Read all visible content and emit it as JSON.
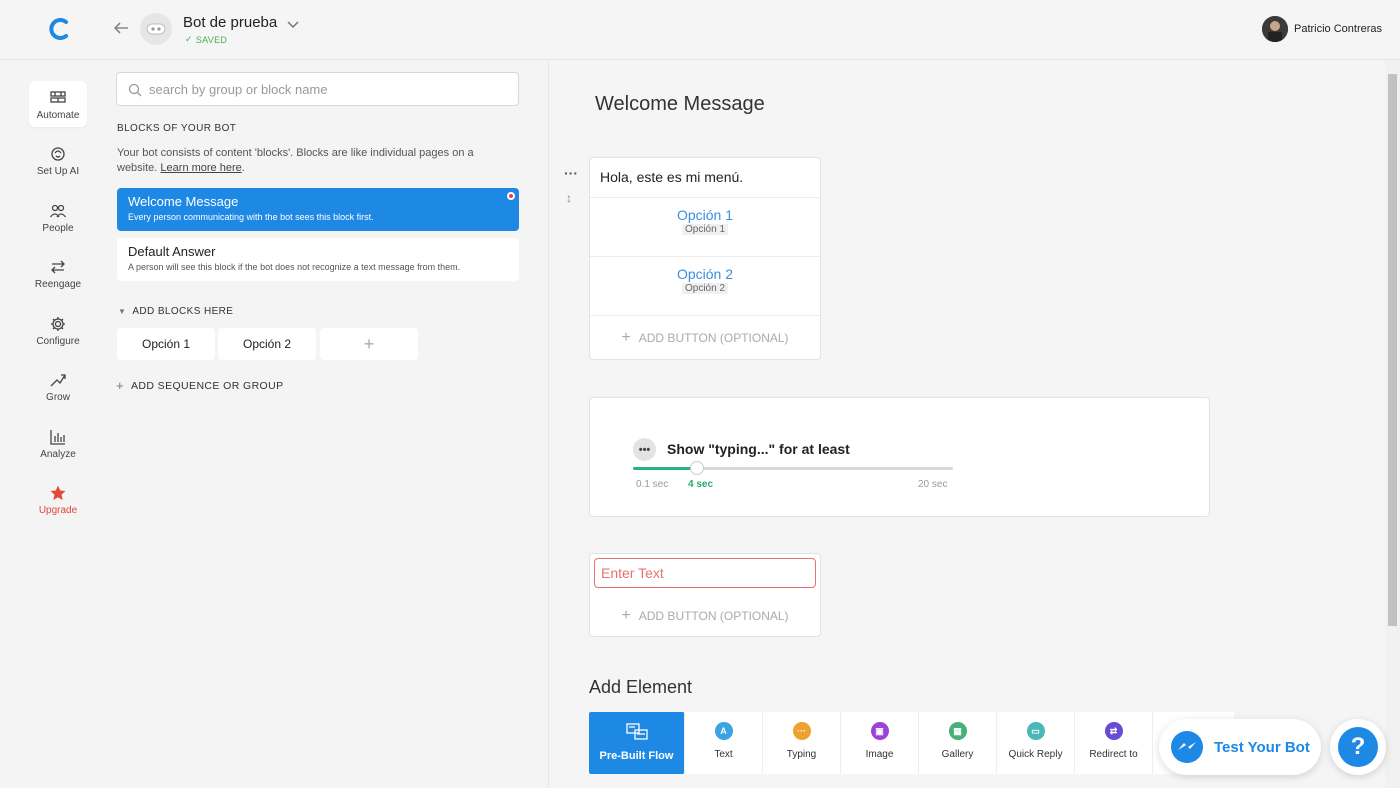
{
  "header": {
    "bot_name": "Bot de prueba",
    "saved_status": "SAVED",
    "user_name": "Patricio Contreras"
  },
  "nav": {
    "items": [
      {
        "label": "Automate",
        "icon": "automate-icon"
      },
      {
        "label": "Set Up AI",
        "icon": "ai-icon"
      },
      {
        "label": "People",
        "icon": "people-icon"
      },
      {
        "label": "Reengage",
        "icon": "reengage-icon"
      },
      {
        "label": "Configure",
        "icon": "gear-icon"
      },
      {
        "label": "Grow",
        "icon": "grow-icon"
      },
      {
        "label": "Analyze",
        "icon": "analyze-icon"
      },
      {
        "label": "Upgrade",
        "icon": "star-icon"
      }
    ]
  },
  "blocks": {
    "search_placeholder": "search by group or block name",
    "heading": "BLOCKS OF YOUR BOT",
    "description": "Your bot consists of content 'blocks'. Blocks are like individual pages on a website.",
    "learn_more": "Learn more here",
    "cards": [
      {
        "title": "Welcome Message",
        "desc": "Every person communicating with the bot sees this block first."
      },
      {
        "title": "Default Answer",
        "desc": "A person will see this block if the bot does not recognize a text message from them."
      }
    ],
    "add_blocks_label": "ADD BLOCKS HERE",
    "options": [
      "Opción 1",
      "Opción 2"
    ],
    "add_sequence_label": "ADD SEQUENCE OR GROUP"
  },
  "main": {
    "title": "Welcome Message",
    "text_card": {
      "message": "Hola, este es mi menú.",
      "buttons": [
        {
          "title": "Opción 1",
          "sub": "Opción 1"
        },
        {
          "title": "Opción 2",
          "sub": "Opción 2"
        }
      ],
      "add_button": "ADD BUTTON (OPTIONAL)"
    },
    "typing_card": {
      "label": "Show \"typing...\" for at least",
      "min_label": "0.1 sec",
      "current_label": "4 sec",
      "max_label": "20 sec",
      "fraction": 0.2
    },
    "input_card": {
      "placeholder": "Enter Text",
      "add_button": "ADD BUTTON (OPTIONAL)"
    },
    "add_element_title": "Add Element",
    "toolbar": [
      {
        "label": "Pre-Built Flow",
        "icon": "prebuilt-flow-icon"
      },
      {
        "label": "Text",
        "icon": "text-icon",
        "color": "#3aa3e3"
      },
      {
        "label": "Typing",
        "icon": "typing-icon",
        "color": "#f0a030"
      },
      {
        "label": "Image",
        "icon": "image-icon",
        "color": "#9b45d4"
      },
      {
        "label": "Gallery",
        "icon": "gallery-icon",
        "color": "#45b07a"
      },
      {
        "label": "Quick Reply",
        "icon": "quick-reply-icon",
        "color": "#4ab8b8"
      },
      {
        "label": "Redirect to",
        "icon": "redirect-icon",
        "color": "#6a4bd4"
      }
    ]
  },
  "test_bot_label": "Test Your Bot",
  "help_label": "?",
  "colors": {
    "accent": "#1e88e5",
    "saved": "#4caf50",
    "upgrade": "#e4463a",
    "slider": "#28b47c"
  }
}
